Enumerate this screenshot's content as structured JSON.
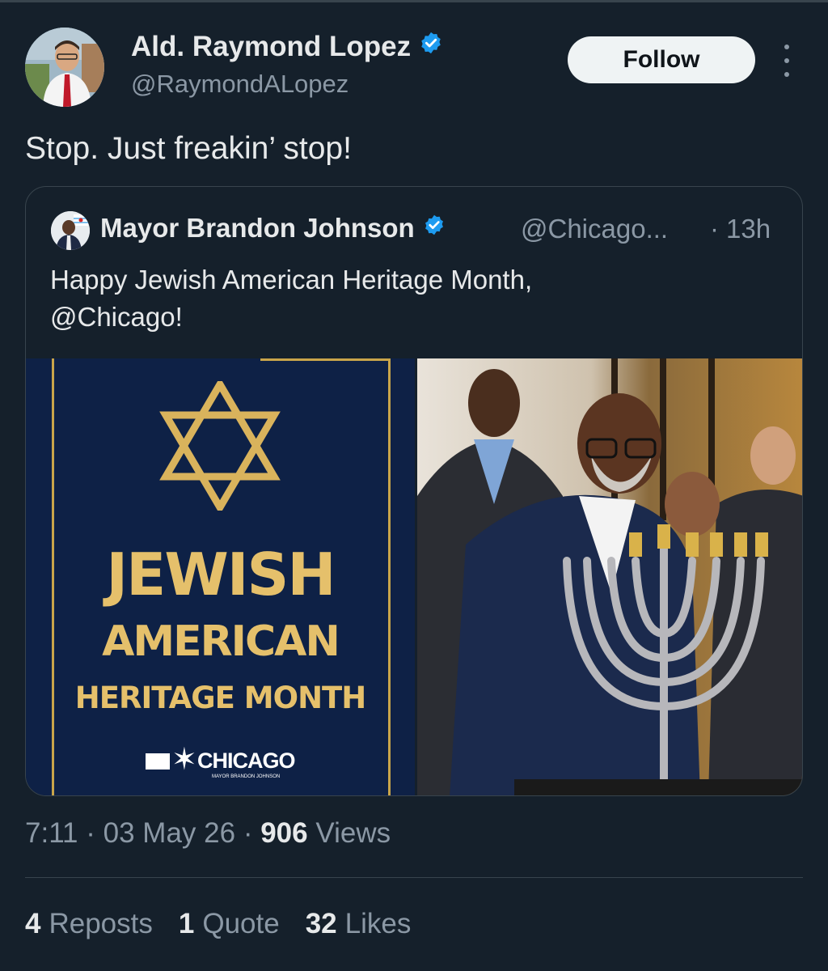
{
  "author": {
    "name": "Ald. Raymond Lopez",
    "handle": "@RaymondALopez",
    "verified": true
  },
  "follow_label": "Follow",
  "tweet_text": "Stop. Just freakin’ stop!",
  "quoted": {
    "name": "Mayor Brandon Johnson",
    "handle": "@Chicago...",
    "separator": "·",
    "time": "13h",
    "text_line1": "Happy Jewish American Heritage Month,",
    "text_line2": "@Chicago!",
    "graphic": {
      "line1": "JEWISH",
      "line2": "AMERICAN",
      "line3": "HERITAGE MONTH",
      "logo_text": "CHICAGO",
      "logo_sub": "MAYOR BRANDON JOHNSON"
    }
  },
  "meta": {
    "time": "7:11",
    "date": "03 May 26",
    "sep": "·",
    "views_count": "906",
    "views_label": "Views"
  },
  "stats": {
    "reposts_count": "4",
    "reposts_label": "Reposts",
    "quotes_count": "1",
    "quotes_label": "Quote",
    "likes_count": "32",
    "likes_label": "Likes"
  },
  "colors": {
    "background": "#15202b",
    "verified": "#1d9bf0",
    "gold": "#e5c06b",
    "navy": "#0e2146"
  }
}
